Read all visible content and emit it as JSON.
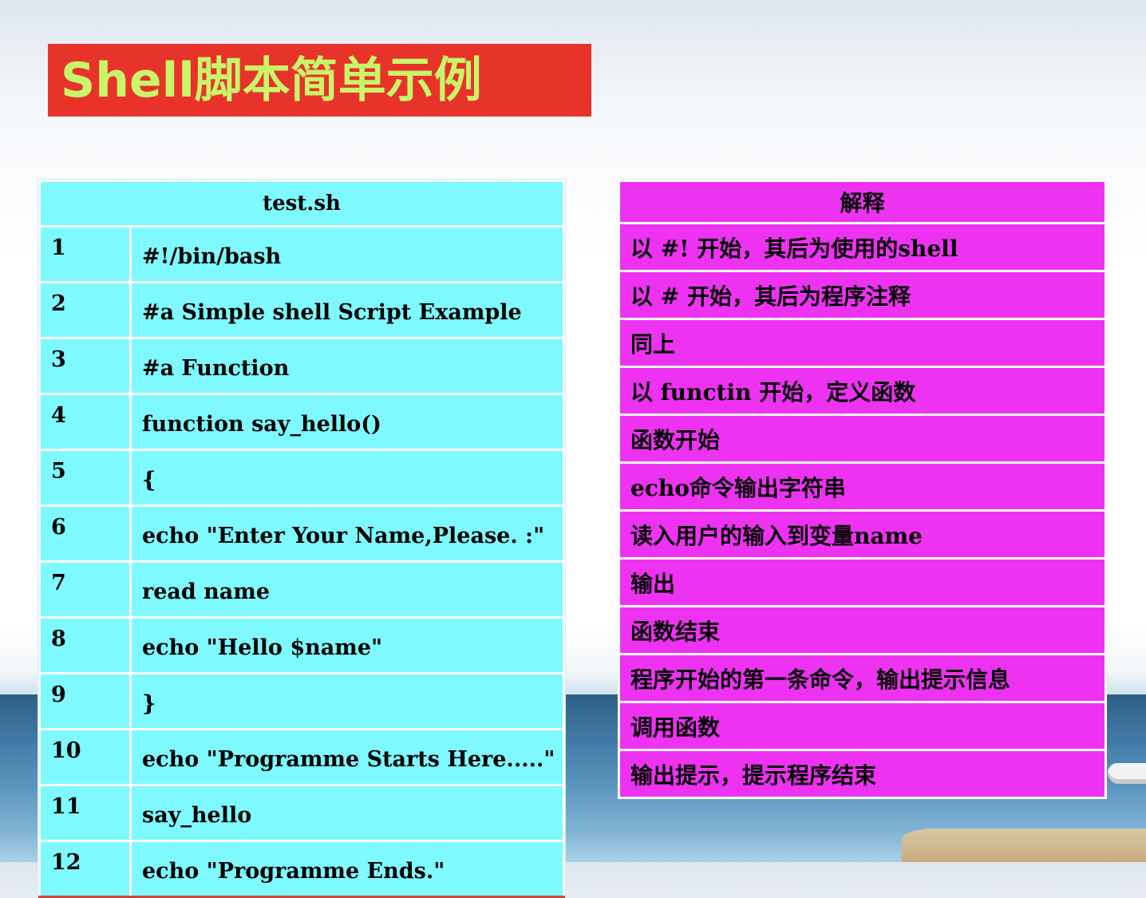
{
  "slide": {
    "title": "Shell脚本简单示例"
  },
  "code_table": {
    "header": "test.sh",
    "rows": [
      {
        "num": "1",
        "code": "#!/bin/bash"
      },
      {
        "num": "2",
        "code": "#a Simple shell Script Example"
      },
      {
        "num": "3",
        "code": "#a Function"
      },
      {
        "num": "4",
        "code": "function say_hello()"
      },
      {
        "num": "5",
        "code": "{"
      },
      {
        "num": "6",
        "code": "echo \"Enter Your Name,Please.  :\""
      },
      {
        "num": "7",
        "code": "read name"
      },
      {
        "num": "8",
        "code": "echo \"Hello $name\""
      },
      {
        "num": "9",
        "code": "}"
      },
      {
        "num": "10",
        "code": "echo \"Programme Starts Here.....\""
      },
      {
        "num": "11",
        "code": "say_hello"
      },
      {
        "num": "12",
        "code": "echo \"Programme Ends.\""
      }
    ]
  },
  "explain_table": {
    "header": "解释",
    "rows": [
      "以 #!  开始，其后为使用的shell",
      "以 #  开始，其后为程序注释",
      "同上",
      "以 functin 开始，定义函数",
      "函数开始",
      "echo命令输出字符串",
      "读入用户的输入到变量name",
      "输出",
      "函数结束",
      "程序开始的第一条命令，输出提示信息",
      "调用函数",
      "输出提示，提示程序结束"
    ]
  },
  "colors": {
    "title_bg": "#e8332a",
    "title_text": "#c8f56a",
    "code_bg": "#7ef9ff",
    "explain_bg": "#ee32f2"
  }
}
